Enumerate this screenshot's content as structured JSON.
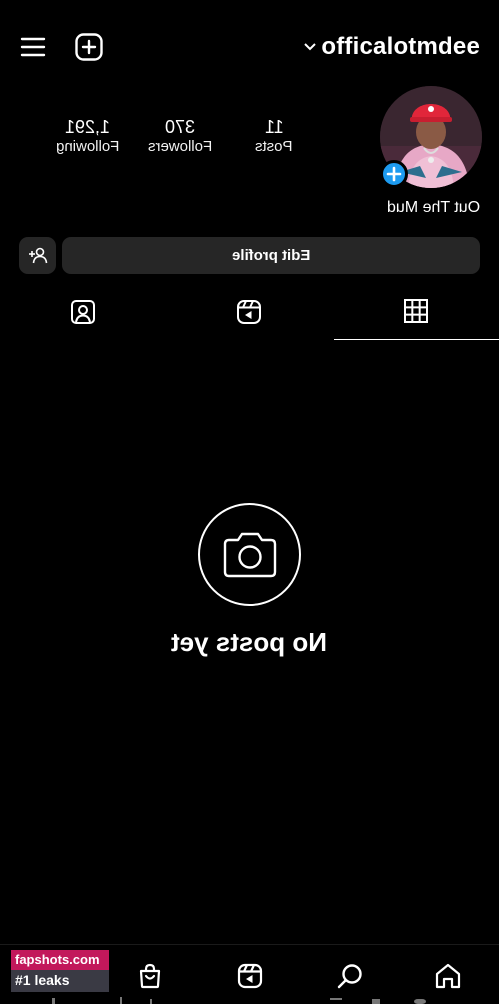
{
  "header": {
    "username": "officalotmdee"
  },
  "profile": {
    "display_name": "Out The Mud",
    "stats": [
      {
        "value": "11",
        "label": "Posts"
      },
      {
        "value": "370",
        "label": "Followers"
      },
      {
        "value": "1,291",
        "label": "Following"
      }
    ]
  },
  "actions": {
    "edit_profile": "Edit profile"
  },
  "tabs": [
    "posts-grid",
    "reels",
    "tagged"
  ],
  "empty_state": {
    "title": "No posts yet"
  },
  "bottom_nav": [
    "home",
    "search",
    "reels",
    "shop",
    "profile"
  ],
  "watermark": {
    "line1": "fapshots.com",
    "line2": "#1 leaks"
  },
  "colors": {
    "background": "#000000",
    "button_bg": "#262626",
    "accent_blue": "#1d9bf0",
    "watermark_pink": "#c2185b"
  }
}
